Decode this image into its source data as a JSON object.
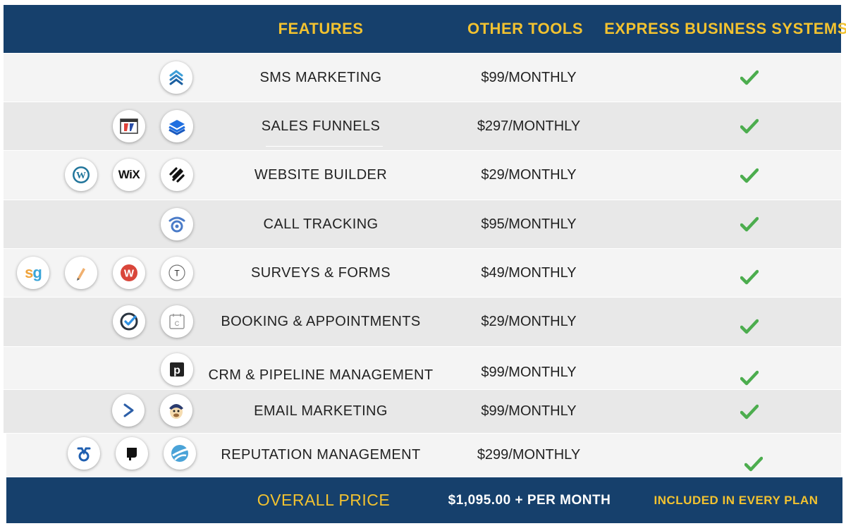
{
  "header": {
    "features": "FEATURES",
    "other_tools": "OTHER TOOLS",
    "express": "EXPRESS BUSINESS SYSTEMS"
  },
  "rows": [
    {
      "feature": "SMS MARKETING",
      "price": "$99/MONTHLY",
      "included": true
    },
    {
      "feature": "SALES FUNNELS",
      "price": "$297/MONTHLY",
      "included": true
    },
    {
      "feature": "WEBSITE BUILDER",
      "price": "$29/MONTHLY",
      "included": true
    },
    {
      "feature": "CALL TRACKING",
      "price": "$95/MONTHLY",
      "included": true
    },
    {
      "feature": "SURVEYS & FORMS",
      "price": "$49/MONTHLY",
      "included": true
    },
    {
      "feature": "BOOKING & APPOINTMENTS",
      "price": "$29/MONTHLY",
      "included": true
    },
    {
      "feature": "CRM & PIPELINE MANAGEMENT",
      "price": "$99/MONTHLY",
      "included": true
    },
    {
      "feature": "EMAIL MARKETING",
      "price": "$99/MONTHLY",
      "included": true
    },
    {
      "feature": "REPUTATION MANAGEMENT",
      "price": "$299/MONTHLY",
      "included": true
    }
  ],
  "icons": {
    "sms": "sms-marketing-logo-icon",
    "clickfunnels": "clickfunnels-logo-icon",
    "funnel_layers": "layers-logo-icon",
    "wordpress": "wordpress-logo-icon",
    "wix": "WiX",
    "squarespace": "squarespace-logo-icon",
    "calltracking": "call-tracking-logo-icon",
    "surveygizmo": "sg",
    "pen": "pen-logo-icon",
    "wufoo": "W",
    "typeform": "T",
    "checkmark_app": "check-circle-logo-icon",
    "calendly": "C",
    "pipedrive": "p",
    "activecampaign": "chevron-right-logo-icon",
    "mailchimp": "mailchimp-logo-icon",
    "birdeye": "birdeye-logo-icon",
    "podium": "podium-logo-icon",
    "reputation": "reputation-logo-icon"
  },
  "footer": {
    "label": "OVERALL PRICE",
    "price": "$1,095.00 + PER MONTH",
    "included": "INCLUDED IN EVERY PLAN"
  },
  "colors": {
    "navy": "#16406c",
    "gold": "#f2c230",
    "check_green": "#4cad4e"
  }
}
